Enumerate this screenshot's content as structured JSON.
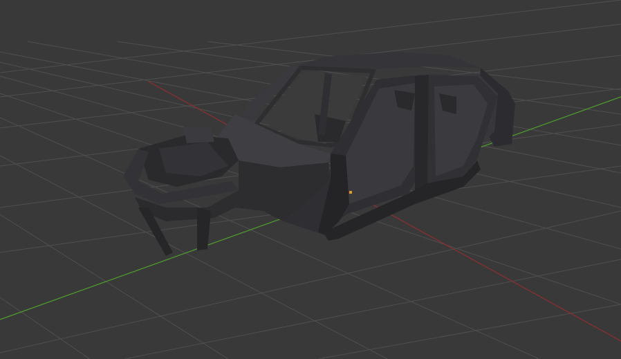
{
  "viewport": {
    "background_color": "#393939",
    "grid_color": "#4f4f4f",
    "x_axis_color": "#8a2f2f",
    "y_axis_color": "#4e9a2d",
    "origin_marker_color": "#e09a2d"
  },
  "model": {
    "body_color": "#2e2e31",
    "body_highlight_color": "#444448",
    "body_shadow_color": "#1d1d20"
  }
}
